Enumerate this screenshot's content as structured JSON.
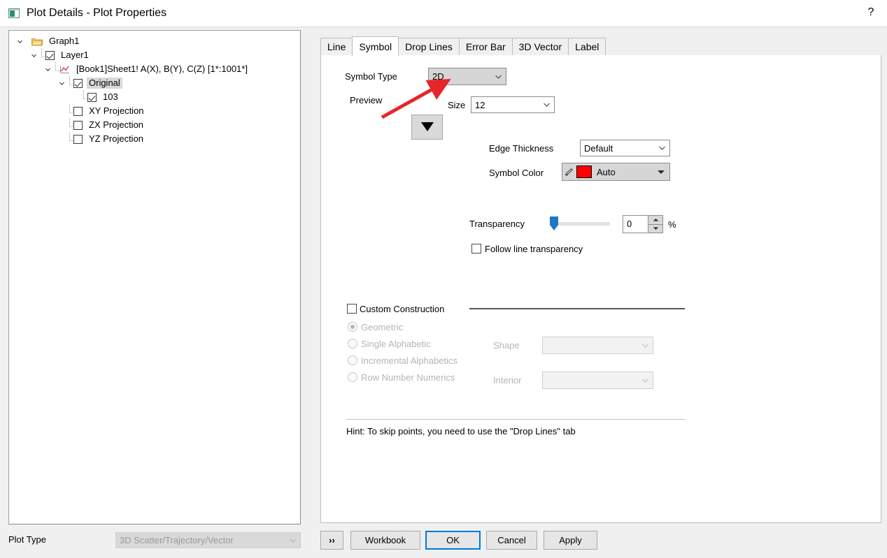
{
  "window": {
    "title": "Plot Details - Plot Properties",
    "icon": "plot-window-icon",
    "help_label": "?"
  },
  "tree": {
    "items": [
      {
        "label": "Graph1",
        "icon": "folder-icon",
        "checkbox": "none",
        "expander": "expanded",
        "selected": false,
        "depth": 0
      },
      {
        "label": "Layer1",
        "icon": "none",
        "checkbox": "checked",
        "expander": "expanded",
        "selected": false,
        "depth": 1
      },
      {
        "label": "[Book1]Sheet1! A(X), B(Y), C(Z) [1*:1001*]",
        "icon": "plot-line-icon",
        "checkbox": "none",
        "expander": "expanded",
        "selected": false,
        "depth": 2
      },
      {
        "label": "Original",
        "icon": "none",
        "checkbox": "checked",
        "expander": "expanded",
        "selected": true,
        "depth": 3
      },
      {
        "label": "103",
        "icon": "none",
        "checkbox": "checked",
        "expander": "none",
        "selected": false,
        "depth": 4
      },
      {
        "label": "XY Projection",
        "icon": "none",
        "checkbox": "unchecked",
        "expander": "none",
        "selected": false,
        "depth": 3
      },
      {
        "label": "ZX Projection",
        "icon": "none",
        "checkbox": "unchecked",
        "expander": "none",
        "selected": false,
        "depth": 3
      },
      {
        "label": "YZ Projection",
        "icon": "none",
        "checkbox": "unchecked",
        "expander": "none",
        "selected": false,
        "depth": 3
      }
    ]
  },
  "tabs": [
    {
      "label": "Line",
      "active": false
    },
    {
      "label": "Symbol",
      "active": true
    },
    {
      "label": "Drop Lines",
      "active": false
    },
    {
      "label": "Error Bar",
      "active": false
    },
    {
      "label": "3D Vector",
      "active": false
    },
    {
      "label": "Label",
      "active": false
    }
  ],
  "symbol_tab": {
    "symbol_type": {
      "label": "Symbol Type",
      "value": "2D"
    },
    "preview": {
      "label": "Preview",
      "symbol": "down-triangle"
    },
    "size": {
      "label": "Size",
      "value": "12"
    },
    "edge_thickness": {
      "label": "Edge Thickness",
      "value": "Default"
    },
    "symbol_color": {
      "label": "Symbol Color",
      "value": "Auto",
      "swatch_hex": "#FF0000"
    },
    "transparency": {
      "label": "Transparency",
      "value": "0",
      "unit": "%",
      "percent": 0
    },
    "follow_line_transparency": {
      "label": "Follow line transparency",
      "checked": false
    },
    "custom_construction": {
      "label": "Custom Construction",
      "checked": false
    },
    "construction_options": [
      {
        "label": "Geometric",
        "selected": true
      },
      {
        "label": "Single Alphabetic",
        "selected": false
      },
      {
        "label": "Incremental Alphabetics",
        "selected": false
      },
      {
        "label": "Row Number Numerics",
        "selected": false
      }
    ],
    "shape": {
      "label": "Shape",
      "value": ""
    },
    "interior": {
      "label": "Interior",
      "value": ""
    },
    "hint": "Hint: To skip points, you need to use the \"Drop Lines\" tab"
  },
  "annotation": {
    "type": "red-arrow",
    "color": "#E8252A",
    "points_to": "symbol-type-combo"
  },
  "footer": {
    "plot_type_label": "Plot Type",
    "plot_type_value": "3D Scatter/Trajectory/Vector",
    "expand_button": "››",
    "workbook_button": "Workbook",
    "ok_button": "OK",
    "cancel_button": "Cancel",
    "apply_button": "Apply"
  },
  "colors": {
    "accent": "#0078D7",
    "symbol_red": "#FF0000",
    "annotation_red": "#E8252A",
    "slider_blue": "#1E78C8"
  }
}
